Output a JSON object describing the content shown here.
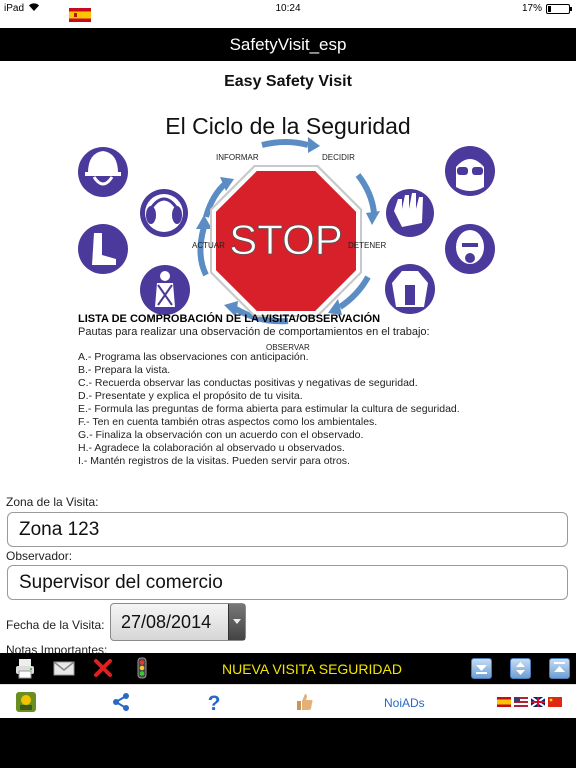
{
  "status_bar": {
    "carrier": "iPad",
    "time": "10:24",
    "battery": "17%",
    "battery_level": 0.17
  },
  "title_bar": {
    "title": "SafetyVisit_esp"
  },
  "content": {
    "app_heading": "Easy Safety Visit",
    "poster": {
      "title": "El Ciclo de la Seguridad",
      "stop_sign": "STOP",
      "cycle_labels": {
        "top_left": "INFORMAR",
        "top_right": "DECIDIR",
        "right": "DETENER",
        "bottom": "OBSERVAR",
        "left": "ACTUAR"
      },
      "icons": [
        "hard-hat-icon",
        "ear-protection-icon",
        "safety-boots-icon",
        "harness-icon",
        "safety-goggles-icon",
        "gloves-icon",
        "respirator-icon",
        "protective-suit-icon"
      ]
    },
    "checklist_title": "LISTA DE COMPROBACIÓN DE LA VISITA/OBSERVACIÓN",
    "checklist_intro": "Pautas para realizar una observación de comportamientos en el trabajo:",
    "checklist_items": [
      "A.- Programa las observaciones con anticipación.",
      "B.- Prepara la vista.",
      "C.- Recuerda observar las conductas positivas y negativas de seguridad.",
      "D.- Presentate y explica el propósito de tu visita.",
      "E.- Formula las preguntas de forma abierta para estimular la cultura de seguridad.",
      "F.- Ten en cuenta también otras aspectos como los ambientales.",
      "G.- Finaliza la observación con un acuerdo con el observado.",
      "H.- Agradece la colaboración al observado u observados.",
      "I.- Mantén registros de la visitas. Pueden servir para otros."
    ]
  },
  "form": {
    "zona_label": "Zona de la Visita:",
    "zona_value": "Zona 123",
    "observador_label": "Observador:",
    "observador_value": "Supervisor del comercio",
    "fecha_label": "Fecha de la Visita:",
    "fecha_value": "27/08/2014",
    "notas_label": "Notas Importantes:"
  },
  "toolbar": {
    "label": "NUEVA VISITA SEGURIDAD",
    "icons": [
      "print-icon",
      "mail-icon",
      "delete-icon",
      "traffic-light-icon",
      "scroll-down-icon",
      "scroll-updown-icon",
      "scroll-top-icon"
    ]
  },
  "tab_bar": {
    "noiads_label": "NoiADs",
    "icons": [
      "app-logo-icon",
      "share-icon",
      "help-icon",
      "thumbs-up-icon",
      "language-flags-icon"
    ]
  },
  "colors": {
    "title_bar": "#000000",
    "toolbar_text": "#f2e600",
    "link_blue": "#2868c8",
    "stop_red": "#d8202a",
    "icon_purple": "#4b3a9c",
    "arrow_blue": "#5b8cc4"
  }
}
